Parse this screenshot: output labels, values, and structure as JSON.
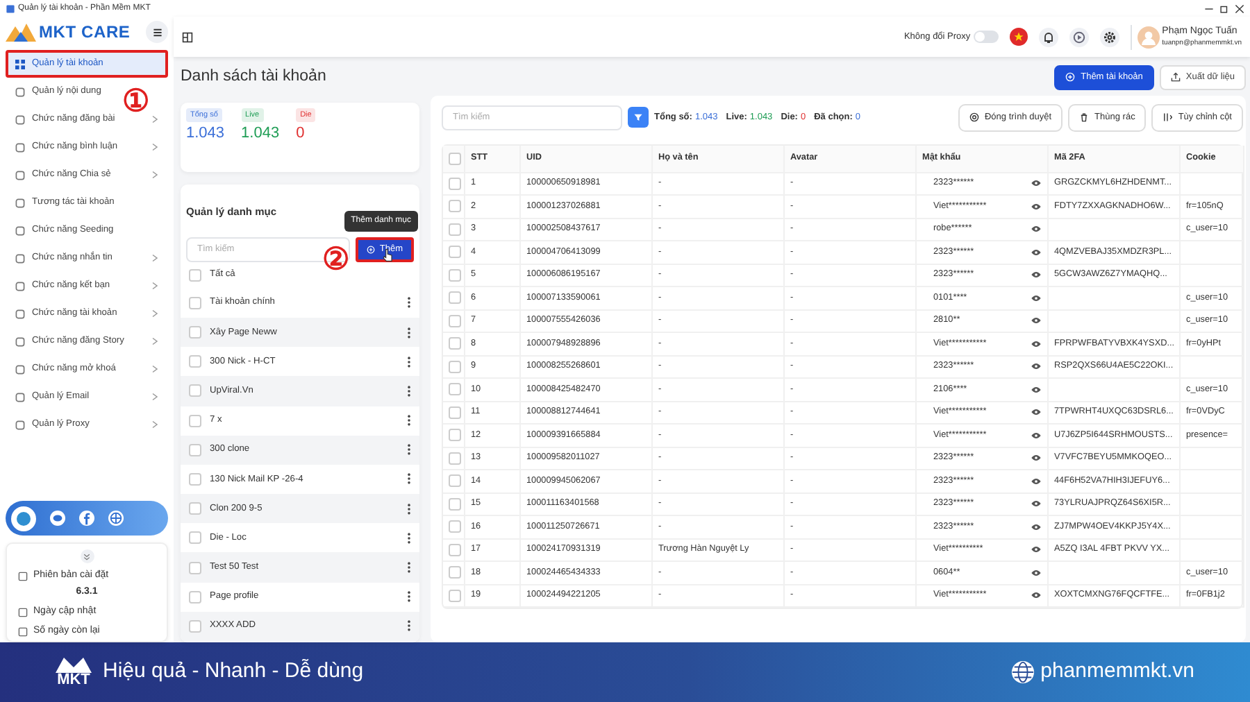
{
  "window": {
    "title": "Quản lý tài khoản - Phần Mềm MKT"
  },
  "sidebar": {
    "logo": "MKT CARE",
    "items": [
      {
        "label": "Quản lý tài khoản",
        "selected": true,
        "highlighted": true,
        "submenu": false
      },
      {
        "label": "Quản lý nội dung",
        "selected": false,
        "highlighted": false,
        "submenu": false
      },
      {
        "label": "Chức năng đăng bài",
        "selected": false,
        "highlighted": false,
        "submenu": true
      },
      {
        "label": "Chức năng bình luận",
        "selected": false,
        "highlighted": false,
        "submenu": true
      },
      {
        "label": "Chức năng Chia sẻ",
        "selected": false,
        "highlighted": false,
        "submenu": true
      },
      {
        "label": "Tương tác tài khoản",
        "selected": false,
        "highlighted": false,
        "submenu": false
      },
      {
        "label": "Chức năng Seeding",
        "selected": false,
        "highlighted": false,
        "submenu": false
      },
      {
        "label": "Chức năng nhắn tin",
        "selected": false,
        "highlighted": false,
        "submenu": true
      },
      {
        "label": "Chức năng kết bạn",
        "selected": false,
        "highlighted": false,
        "submenu": true
      },
      {
        "label": "Chức năng tài khoản",
        "selected": false,
        "highlighted": false,
        "submenu": true
      },
      {
        "label": "Chức năng đăng Story",
        "selected": false,
        "highlighted": false,
        "submenu": true
      },
      {
        "label": "Chức năng mở khoá",
        "selected": false,
        "highlighted": false,
        "submenu": true
      },
      {
        "label": "Quản lý Email",
        "selected": false,
        "highlighted": false,
        "submenu": true
      },
      {
        "label": "Quản lý Proxy",
        "selected": false,
        "highlighted": false,
        "submenu": true
      }
    ],
    "info": [
      {
        "label": "Phiên bản cài đặt",
        "value": "6.3.1"
      },
      {
        "label": "Ngày cập nhật"
      },
      {
        "label": "Số ngày còn lại"
      }
    ]
  },
  "header": {
    "proxy": {
      "label": "Không đổi Proxy",
      "on": false
    },
    "user": {
      "name": "Phạm Ngọc Tuấn",
      "email": "tuanpn@phanmemmkt.vn"
    }
  },
  "page": {
    "title": "Danh sách tài khoản",
    "buttons": [
      {
        "label": "Thêm tài khoản",
        "kind": "primary"
      },
      {
        "label": "Xuất dữ liệu",
        "kind": "outline"
      }
    ]
  },
  "stats": [
    {
      "label": "Tổng số",
      "value": "1.043",
      "color": "#3b6fd8"
    },
    {
      "label": "Live",
      "value": "1.043",
      "color": "#1f9d55"
    },
    {
      "label": "Die",
      "value": "0",
      "color": "#e03131"
    }
  ],
  "categories": {
    "title": "Quản lý danh mục",
    "search": {
      "placeholder": "Tìm kiếm"
    },
    "add_button": {
      "label": "Thêm",
      "highlighted": true
    },
    "tooltip": "Thêm danh mục",
    "all": {
      "label": "Tất cả",
      "checked": false
    },
    "items": [
      {
        "label": "Tài khoản chính",
        "checked": false
      },
      {
        "label": "Xây Page Neww",
        "checked": false
      },
      {
        "label": "300 Nick - H-CT",
        "checked": false
      },
      {
        "label": "UpViral.Vn",
        "checked": false
      },
      {
        "label": "7 x",
        "checked": false
      },
      {
        "label": "300 clone",
        "checked": false
      },
      {
        "label": "130 Nick Mail KP -26-4",
        "checked": false
      },
      {
        "label": "Clon 200 9-5",
        "checked": false
      },
      {
        "label": "Die - Loc",
        "checked": false
      },
      {
        "label": "Test 50 Test",
        "checked": false
      },
      {
        "label": "Page profile",
        "checked": false
      },
      {
        "label": "XXXX ADD",
        "checked": false
      }
    ]
  },
  "toolbar": {
    "search": {
      "placeholder": "Tìm kiếm"
    },
    "summary": [
      {
        "label": "Tổng số:",
        "value": "1.043",
        "color": "#3b6fd8"
      },
      {
        "label": "Live:",
        "value": "1.043",
        "color": "#1f9d55"
      },
      {
        "label": "Die:",
        "value": "0",
        "color": "#e03131"
      },
      {
        "label": "Đã chọn:",
        "value": "0",
        "color": "#3b6fd8"
      }
    ],
    "buttons": [
      {
        "label": "Đóng trình duyệt",
        "kind": "browser"
      },
      {
        "label": "Thùng rác",
        "kind": "trash"
      },
      {
        "label": "Tùy chỉnh cột",
        "kind": "columns"
      }
    ]
  },
  "table": {
    "select_all": {
      "checked": false
    },
    "columns": [
      "STT",
      "UID",
      "Họ và tên",
      "Avatar",
      "Mật khẩu",
      "Mã 2FA",
      "Cookie"
    ],
    "rows": [
      {
        "stt": "1",
        "uid": "100000650918981",
        "name": "-",
        "avatar": "-",
        "password": "2323******",
        "twofa": "GRGZCKMYL6HZHDENMT...",
        "checked": false
      },
      {
        "stt": "2",
        "uid": "100001237026881",
        "name": "-",
        "avatar": "-",
        "password": "Viet***********",
        "twofa": "FDTY7ZXXAGKNADHO6W...",
        "cookie": "fr=105nQ",
        "checked": false
      },
      {
        "stt": "3",
        "uid": "100002508437617",
        "name": "-",
        "avatar": "-",
        "password": "robe******",
        "cookie": "c_user=10",
        "checked": false
      },
      {
        "stt": "4",
        "uid": "100004706413099",
        "name": "-",
        "avatar": "-",
        "password": "2323******",
        "twofa": "4QMZVEBAJ35XMDZR3PL...",
        "checked": false
      },
      {
        "stt": "5",
        "uid": "100006086195167",
        "name": "-",
        "avatar": "-",
        "password": "2323******",
        "twofa": "5GCW3AWZ6Z7YMAQHQ...",
        "checked": false
      },
      {
        "stt": "6",
        "uid": "100007133590061",
        "name": "-",
        "avatar": "-",
        "password": "0101****",
        "cookie": "c_user=10",
        "checked": false
      },
      {
        "stt": "7",
        "uid": "100007555426036",
        "name": "-",
        "avatar": "-",
        "password": "2810**",
        "cookie": "c_user=10",
        "checked": false
      },
      {
        "stt": "8",
        "uid": "100007948928896",
        "name": "-",
        "avatar": "-",
        "password": "Viet***********",
        "twofa": "FPRPWFBATYVBXK4YSXD...",
        "cookie": "fr=0yHPt",
        "checked": false
      },
      {
        "stt": "9",
        "uid": "100008255268601",
        "name": "-",
        "avatar": "-",
        "password": "2323******",
        "twofa": "RSP2QXS66U4AE5C22OKI...",
        "checked": false
      },
      {
        "stt": "10",
        "uid": "100008425482470",
        "name": "-",
        "avatar": "-",
        "password": "2106****",
        "cookie": "c_user=10",
        "checked": false
      },
      {
        "stt": "11",
        "uid": "100008812744641",
        "name": "-",
        "avatar": "-",
        "password": "Viet***********",
        "twofa": "7TPWRHT4UXQC63DSRL6...",
        "cookie": "fr=0VDyC",
        "checked": false
      },
      {
        "stt": "12",
        "uid": "100009391665884",
        "name": "-",
        "avatar": "-",
        "password": "Viet***********",
        "twofa": "U7J6ZP5I644SRHMOUSTS...",
        "cookie": "presence=",
        "checked": false
      },
      {
        "stt": "13",
        "uid": "100009582011027",
        "name": "-",
        "avatar": "-",
        "password": "2323******",
        "twofa": "V7VFC7BEYU5MMKOQEO...",
        "checked": false
      },
      {
        "stt": "14",
        "uid": "100009945062067",
        "name": "-",
        "avatar": "-",
        "password": "2323******",
        "twofa": "44F6H52VA7HIH3IJEFUY6...",
        "checked": false
      },
      {
        "stt": "15",
        "uid": "100011163401568",
        "name": "-",
        "avatar": "-",
        "password": "2323******",
        "twofa": "73YLRUAJPRQZ64S6XI5R...",
        "checked": false
      },
      {
        "stt": "16",
        "uid": "100011250726671",
        "name": "-",
        "avatar": "-",
        "password": "2323******",
        "twofa": "ZJ7MPW4OEV4KKPJ5Y4X...",
        "checked": false
      },
      {
        "stt": "17",
        "uid": "100024170931319",
        "name": "Trương Hàn Nguyệt Ly",
        "avatar": "-",
        "password": "Viet**********",
        "twofa": "A5ZQ I3AL 4FBT PKVV YX...",
        "checked": false
      },
      {
        "stt": "18",
        "uid": "100024465434333",
        "name": "-",
        "avatar": "-",
        "password": "0604**",
        "cookie": "c_user=10",
        "checked": false
      },
      {
        "stt": "19",
        "uid": "100024494221205",
        "name": "-",
        "avatar": "-",
        "password": "Viet***********",
        "twofa": "XOXTCMXNG76FQCFTFE...",
        "cookie": "fr=0FB1j2",
        "checked": false
      }
    ]
  },
  "annotations": [
    {
      "label": "①"
    },
    {
      "label": "②"
    }
  ],
  "banner": {
    "logo": "MKT",
    "slogan": "Hiệu quả - Nhanh - Dễ dùng",
    "website": "phanmemmkt.vn"
  }
}
